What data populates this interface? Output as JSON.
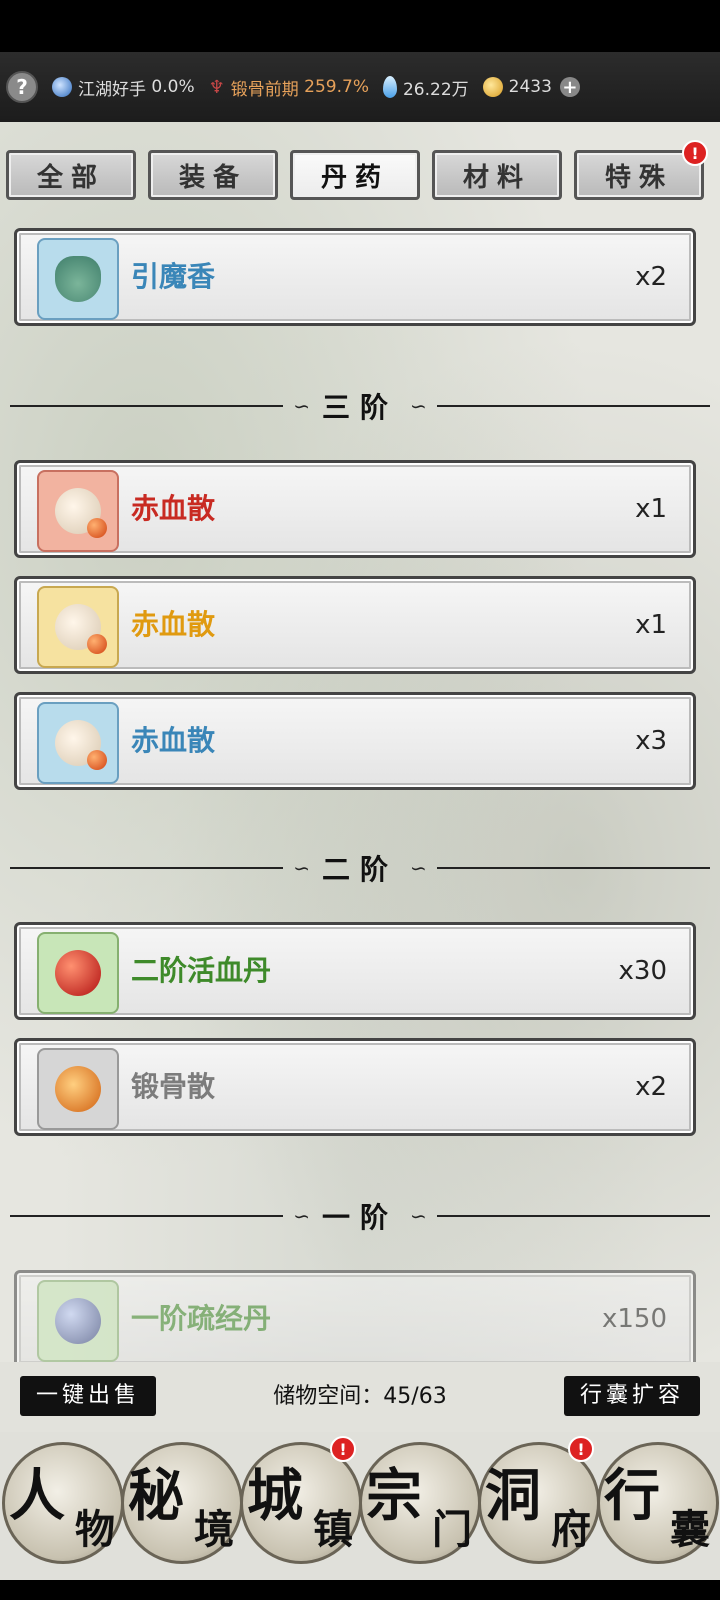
{
  "topbar": {
    "help_label": "?",
    "stats": [
      {
        "icon": "taiji-icon",
        "label": "江湖好手",
        "value": "0.0%",
        "color": "#dddddd"
      },
      {
        "icon": "bone-icon",
        "label": "锻骨前期",
        "value": "259.7%",
        "color": "#e6a15a"
      },
      {
        "icon": "spirit-drop-icon",
        "label": "",
        "value": "26.22万",
        "color": "#dddddd"
      },
      {
        "icon": "coin-icon",
        "label": "",
        "value": "2433",
        "color": "#dddddd"
      }
    ],
    "plus_label": "+"
  },
  "tabs": [
    {
      "label": "全部",
      "active": false
    },
    {
      "label": "装备",
      "active": false
    },
    {
      "label": "丹药",
      "active": true
    },
    {
      "label": "材料",
      "active": false
    },
    {
      "label": "特殊",
      "active": false,
      "badge": "!"
    }
  ],
  "sections": {
    "tier3": "三阶",
    "tier2": "二阶",
    "tier1": "一阶"
  },
  "items": [
    {
      "name": "引魔香",
      "qty": "x2",
      "rarity": "blue",
      "icon": "censer-icon"
    },
    {
      "name": "赤血散",
      "qty": "x1",
      "rarity": "red",
      "icon": "pouch-icon"
    },
    {
      "name": "赤血散",
      "qty": "x1",
      "rarity": "yellow",
      "icon": "pouch-icon"
    },
    {
      "name": "赤血散",
      "qty": "x3",
      "rarity": "blue",
      "icon": "pouch-icon"
    },
    {
      "name": "二阶活血丹",
      "qty": "x30",
      "rarity": "green",
      "icon": "pill-icon"
    },
    {
      "name": "锻骨散",
      "qty": "x2",
      "rarity": "gray",
      "icon": "gourd-icon"
    },
    {
      "name": "一阶疏经丹",
      "qty": "x150",
      "rarity": "green",
      "icon": "blue-pill-icon"
    }
  ],
  "footer": {
    "sell_all": "一键出售",
    "storage": "储物空间：45/63",
    "expand": "行囊扩容"
  },
  "nav": [
    {
      "big": "人",
      "small": "物",
      "badge": ""
    },
    {
      "big": "秘",
      "small": "境",
      "badge": ""
    },
    {
      "big": "城",
      "small": "镇",
      "badge": "!"
    },
    {
      "big": "宗",
      "small": "门",
      "badge": ""
    },
    {
      "big": "洞",
      "small": "府",
      "badge": "!"
    },
    {
      "big": "行",
      "small": "囊",
      "badge": ""
    }
  ]
}
